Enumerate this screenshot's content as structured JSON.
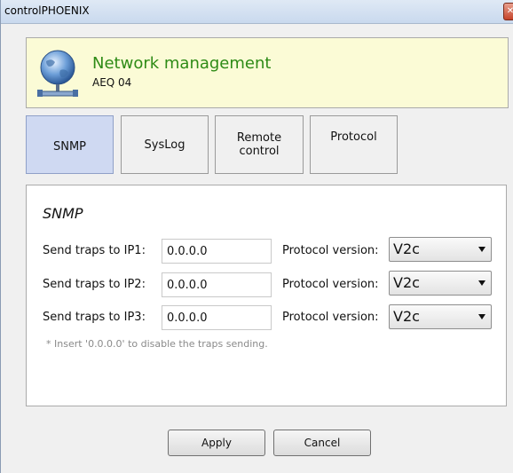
{
  "window": {
    "title": "controlPHOENIX",
    "close_glyph": "✕"
  },
  "header": {
    "title": "Network management",
    "subtitle": "AEQ 04",
    "icon": "globe-network-icon"
  },
  "tabs": [
    {
      "label": "SNMP",
      "active": true
    },
    {
      "label": "SysLog",
      "active": false
    },
    {
      "label": "Remote control",
      "active": false
    },
    {
      "label": "Protocol",
      "active": false
    }
  ],
  "panel": {
    "title": "SNMP",
    "rows": [
      {
        "label": "Send traps to IP1:",
        "ip": "0.0.0.0",
        "pv_label": "Protocol version:",
        "pv_value": "V2c"
      },
      {
        "label": "Send traps to IP2:",
        "ip": "0.0.0.0",
        "pv_label": "Protocol version:",
        "pv_value": "V2c"
      },
      {
        "label": "Send traps to IP3:",
        "ip": "0.0.0.0",
        "pv_label": "Protocol version:",
        "pv_value": "V2c"
      }
    ],
    "note": "* Insert '0.0.0.0' to disable the traps sending."
  },
  "buttons": {
    "apply": "Apply",
    "cancel": "Cancel"
  },
  "colors": {
    "header_bg": "#fbfbd6",
    "header_title": "#2e8b16",
    "active_tab": "#cfd9f2"
  }
}
